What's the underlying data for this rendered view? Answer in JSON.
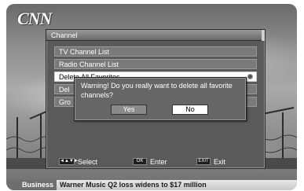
{
  "channel_logo": "CNN",
  "menu": {
    "title": "Channel",
    "items": [
      {
        "label": "TV Channel List"
      },
      {
        "label": "Radio Channel List"
      },
      {
        "label": "Delete All Favorites"
      },
      {
        "label": "Del"
      },
      {
        "label": "Gro"
      }
    ],
    "selected_index": 2
  },
  "help_bar": {
    "select_key": "◄▲▼►",
    "select_label": "Select",
    "enter_key": "OK",
    "enter_label": "Enter",
    "exit_key": "EXIT",
    "exit_label": "Exit"
  },
  "dialog": {
    "message": "Warning! Do you really want to delete all favorite channels?",
    "yes_label": "Yes",
    "no_label": "No",
    "focused_button": "No"
  },
  "ticker": {
    "category": "Business",
    "headline": "Warner Music Q2 loss widens to $17 million"
  },
  "icons": {
    "favorites_icon": "circle-favorite-icon",
    "select_keys_icon": "arrow-keys-icon"
  },
  "colors": {
    "menu_background": "#5a5a5a",
    "selected_item": "#ffffff",
    "dialog_background": "#666666"
  }
}
